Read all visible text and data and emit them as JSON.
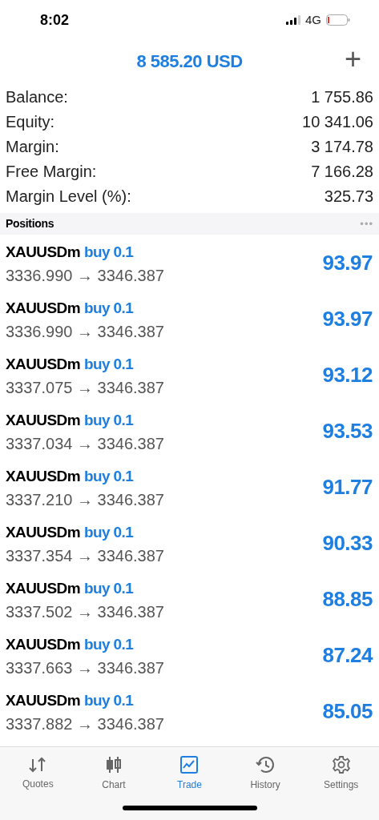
{
  "status_bar": {
    "time": "8:02",
    "network": "4G"
  },
  "header": {
    "title": "8 585.20 USD",
    "add_button": "+"
  },
  "summary": [
    {
      "label": "Balance:",
      "value": "1 755.86"
    },
    {
      "label": "Equity:",
      "value": "10 341.06"
    },
    {
      "label": "Margin:",
      "value": "3 174.78"
    },
    {
      "label": "Free Margin:",
      "value": "7 166.28"
    },
    {
      "label": "Margin Level (%):",
      "value": "325.73"
    }
  ],
  "positions_header": {
    "title": "Positions",
    "menu": "•••"
  },
  "positions": [
    {
      "symbol": "XAUUSDm",
      "side": "buy 0.1",
      "prices": "3336.990 → 3346.387",
      "profit": "93.97"
    },
    {
      "symbol": "XAUUSDm",
      "side": "buy 0.1",
      "prices": "3336.990 → 3346.387",
      "profit": "93.97"
    },
    {
      "symbol": "XAUUSDm",
      "side": "buy 0.1",
      "prices": "3337.075 → 3346.387",
      "profit": "93.12"
    },
    {
      "symbol": "XAUUSDm",
      "side": "buy 0.1",
      "prices": "3337.034 → 3346.387",
      "profit": "93.53"
    },
    {
      "symbol": "XAUUSDm",
      "side": "buy 0.1",
      "prices": "3337.210 → 3346.387",
      "profit": "91.77"
    },
    {
      "symbol": "XAUUSDm",
      "side": "buy 0.1",
      "prices": "3337.354 → 3346.387",
      "profit": "90.33"
    },
    {
      "symbol": "XAUUSDm",
      "side": "buy 0.1",
      "prices": "3337.502 → 3346.387",
      "profit": "88.85"
    },
    {
      "symbol": "XAUUSDm",
      "side": "buy 0.1",
      "prices": "3337.663 → 3346.387",
      "profit": "87.24"
    },
    {
      "symbol": "XAUUSDm",
      "side": "buy 0.1",
      "prices": "3337.882 → 3346.387",
      "profit": "85.05"
    }
  ],
  "tabs": [
    {
      "kind": "quotes",
      "label": "Quotes",
      "selected": false
    },
    {
      "kind": "chart",
      "label": "Chart",
      "selected": false
    },
    {
      "kind": "trade",
      "label": "Trade",
      "selected": true
    },
    {
      "kind": "history",
      "label": "History",
      "selected": false
    },
    {
      "kind": "settings",
      "label": "Settings",
      "selected": false
    }
  ]
}
